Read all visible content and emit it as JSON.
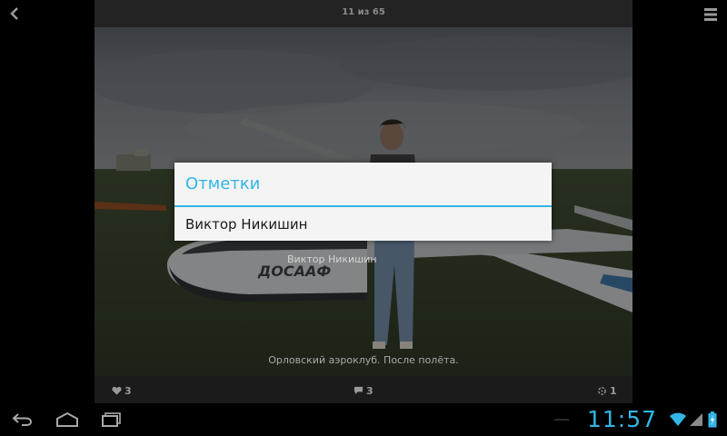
{
  "app": {
    "counter": "11 из 65"
  },
  "photo": {
    "tag_label": "Виктор Никишин",
    "caption": "Орловский аэроклуб. После полёта."
  },
  "stats": {
    "likes": "3",
    "comments": "3",
    "tags": "1"
  },
  "dialog": {
    "title": "Отметки",
    "items": [
      {
        "label": "Виктор Никишин"
      }
    ]
  },
  "status_bar": {
    "time": "11:57"
  },
  "icons": {
    "back": "back-arrow-icon",
    "menu": "overflow-menu-icon",
    "likes": "heart-icon",
    "comments": "comment-icon",
    "tags": "tag-target-icon",
    "nav_back": "nav-back-icon",
    "nav_home": "nav-home-icon",
    "nav_recent": "nav-recent-apps-icon",
    "wifi": "wifi-icon",
    "signal": "signal-icon",
    "battery": "battery-icon"
  },
  "colors": {
    "accent": "#33b5e5",
    "dialog_bg": "#f4f4f4"
  }
}
